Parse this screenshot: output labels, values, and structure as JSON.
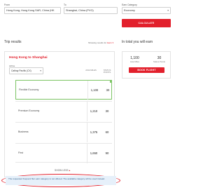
{
  "form": {
    "from_label": "From",
    "from_value": "Hong Kong, Hong Kong SAR, China (HK",
    "to_label": "To",
    "to_value": "Shanghai, China (PVG)",
    "cabin_label": "Earn Category",
    "cabin_value": "Economy",
    "calculate_label": "CALCULATE"
  },
  "trip": {
    "title": "Trip results",
    "showing_text": "Showing results for",
    "showing_value": "Earn",
    "route_title": "Hong Kong to Shanghai",
    "airline_label": "Airline",
    "airline_value": "Cathay Pacific (CX)",
    "col_asia_miles": "ASIA MILES",
    "col_status_points": "STATUS POINTS",
    "rows": [
      {
        "label": "Flexible Economy",
        "miles": "1,100",
        "points": "30"
      },
      {
        "label": "Premium Economy",
        "miles": "1,210",
        "points": "30"
      },
      {
        "label": "Business",
        "miles": "1,375",
        "points": "60"
      },
      {
        "label": "First",
        "miles": "1,650",
        "points": "90"
      }
    ],
    "show_less": "SHOW LESS",
    "notice": "The requested frequent flier earn category is not offered. The available category will be used instead."
  },
  "earn": {
    "title": "In total you will earn",
    "miles_value": "1,100",
    "miles_label": "Asia Miles",
    "points_value": "30",
    "points_label": "Status Points",
    "book_label": "BOOK FLIGHT"
  },
  "colors": {
    "accent": "#e2202c",
    "selected_row_border": "#7cc464",
    "notice_bg": "#e6f0fa",
    "notice_ring": "#e2202c"
  }
}
